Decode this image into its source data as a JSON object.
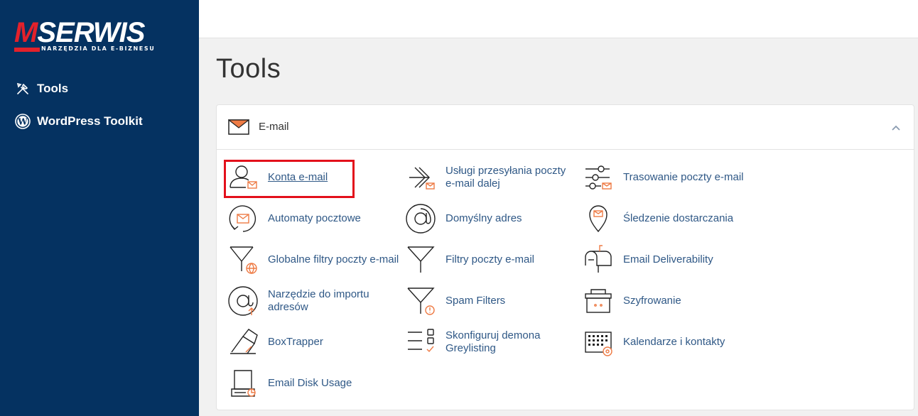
{
  "logo": {
    "text": "SERWIS",
    "m": "M",
    "tagline": "NARZĘDZIA DLA E-BIZNESU"
  },
  "sidebar": {
    "items": [
      {
        "label": "Tools",
        "icon": "tools-icon"
      },
      {
        "label": "WordPress Toolkit",
        "icon": "wordpress-icon"
      }
    ]
  },
  "main": {
    "title": "Tools",
    "section": {
      "title": "E-mail",
      "items": [
        {
          "label": "Konta e-mail",
          "icon": "email-accounts-icon"
        },
        {
          "label": "Usługi przesyłania poczty e-mail dalej",
          "icon": "forwarders-icon"
        },
        {
          "label": "Trasowanie poczty e-mail",
          "icon": "email-routing-icon"
        },
        {
          "label": "Automaty pocztowe",
          "icon": "autoresponders-icon"
        },
        {
          "label": "Domyślny adres",
          "icon": "default-address-icon"
        },
        {
          "label": "Śledzenie dostarczania",
          "icon": "track-delivery-icon"
        },
        {
          "label": "Globalne filtry poczty e-mail",
          "icon": "global-filters-icon"
        },
        {
          "label": "Filtry poczty e-mail",
          "icon": "email-filters-icon"
        },
        {
          "label": "Email Deliverability",
          "icon": "deliverability-icon"
        },
        {
          "label": "Narzędzie do importu adresów",
          "icon": "address-importer-icon"
        },
        {
          "label": "Spam Filters",
          "icon": "spam-filters-icon"
        },
        {
          "label": "Szyfrowanie",
          "icon": "encryption-icon"
        },
        {
          "label": "BoxTrapper",
          "icon": "boxtrapper-icon"
        },
        {
          "label": "Skonfiguruj demona Greylisting",
          "icon": "greylisting-icon"
        },
        {
          "label": "Kalendarze i kontakty",
          "icon": "calendars-contacts-icon"
        },
        {
          "label": "Email Disk Usage",
          "icon": "disk-usage-icon"
        }
      ]
    }
  },
  "colors": {
    "sidebar": "#053261",
    "accent": "#e3212b",
    "link": "#2f5886",
    "icon_accent": "#ee7b45"
  }
}
